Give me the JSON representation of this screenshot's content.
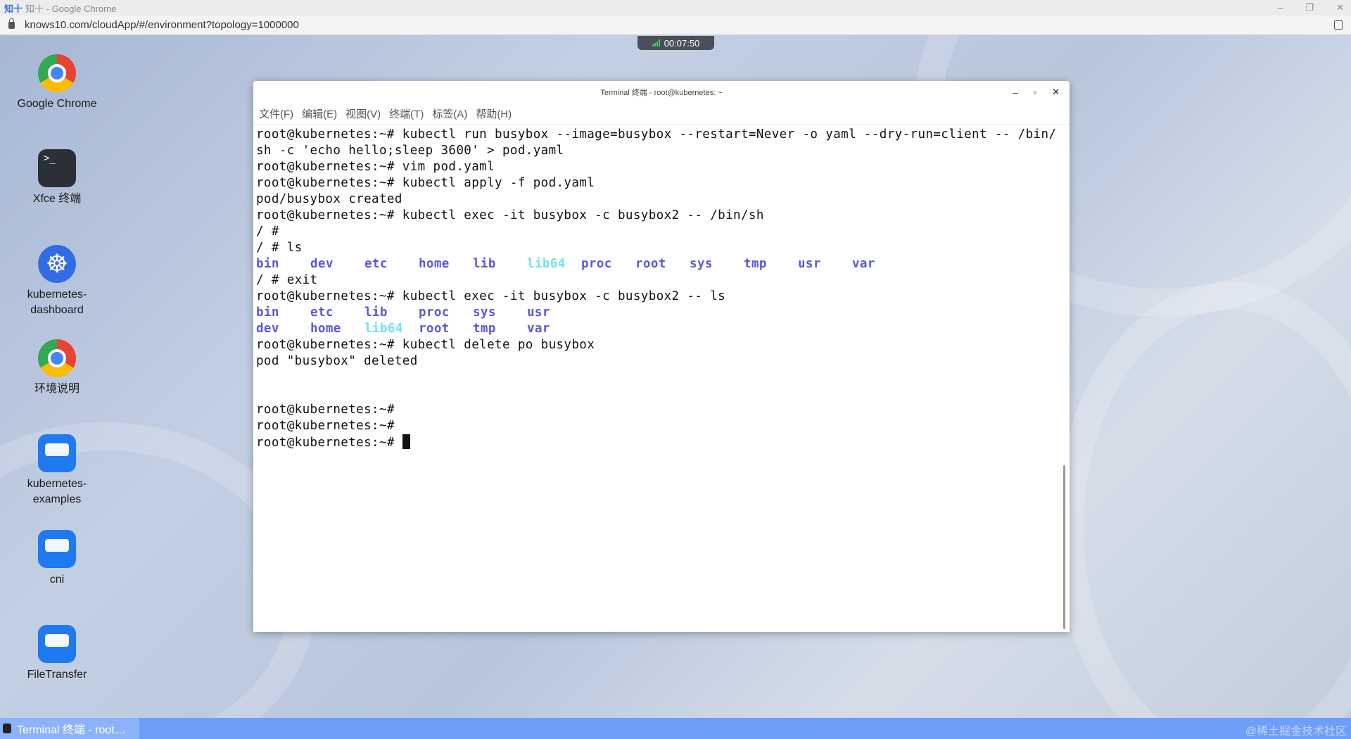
{
  "browser": {
    "title_logo": "知十",
    "title": "知十 - Google Chrome",
    "url": "knows10.com/cloudApp/#/environment?topology=1000000",
    "controls": [
      "–",
      "❐",
      "✕"
    ]
  },
  "timer": "00:07:50",
  "desktop_icons": [
    {
      "label": "Google Chrome",
      "icon": "chrome-icon"
    },
    {
      "label": "Xfce 终端",
      "icon": "terminal-icon"
    },
    {
      "label": "kubernetes-dashboard",
      "icon": "kubernetes-icon"
    },
    {
      "label": "环境说明",
      "icon": "chrome-icon"
    },
    {
      "label": "kubernetes-examples",
      "icon": "folder-icon"
    },
    {
      "label": "cni",
      "icon": "folder-icon"
    },
    {
      "label": "FileTransfer",
      "icon": "folder-icon"
    }
  ],
  "terminal": {
    "title": "Terminal 终端 - root@kubernetes: ~",
    "controls": [
      "–",
      "▫",
      "✕"
    ],
    "menu": [
      "文件(F)",
      "编辑(E)",
      "视图(V)",
      "终端(T)",
      "标签(A)",
      "帮助(H)"
    ],
    "lines": [
      "root@kubernetes:~# kubectl run busybox --image=busybox --restart=Never -o yaml --dry-run=client -- /bin/",
      "sh -c 'echo hello;sleep 3600' > pod.yaml",
      "root@kubernetes:~# vim pod.yaml",
      "root@kubernetes:~# kubectl apply -f pod.yaml",
      "pod/busybox created",
      "root@kubernetes:~# kubectl exec -it busybox -c busybox2 -- /bin/sh",
      "/ # ",
      "/ # ls"
    ],
    "ls1": [
      "bin",
      "dev",
      "etc",
      "home",
      "lib",
      "lib64",
      "proc",
      "root",
      "sys",
      "tmp",
      "usr",
      "var"
    ],
    "lines2": [
      "/ # exit",
      "root@kubernetes:~# kubectl exec -it busybox -c busybox2 -- ls"
    ],
    "ls2a": [
      "bin",
      "etc",
      "lib",
      "proc",
      "sys",
      "usr"
    ],
    "ls2b": [
      "dev",
      "home",
      "lib64",
      "root",
      "tmp",
      "var"
    ],
    "lines3": [
      "root@kubernetes:~# kubectl delete po busybox",
      "pod \"busybox\" deleted",
      "",
      "",
      "root@kubernetes:~#",
      "root@kubernetes:~#",
      "root@kubernetes:~# "
    ],
    "colors": {
      "dir": "#5b57d8",
      "link": "#6fe3f0"
    }
  },
  "taskbar": {
    "item": "Terminal 终端 - root…",
    "watermark": "@稀土掘金技术社区"
  }
}
